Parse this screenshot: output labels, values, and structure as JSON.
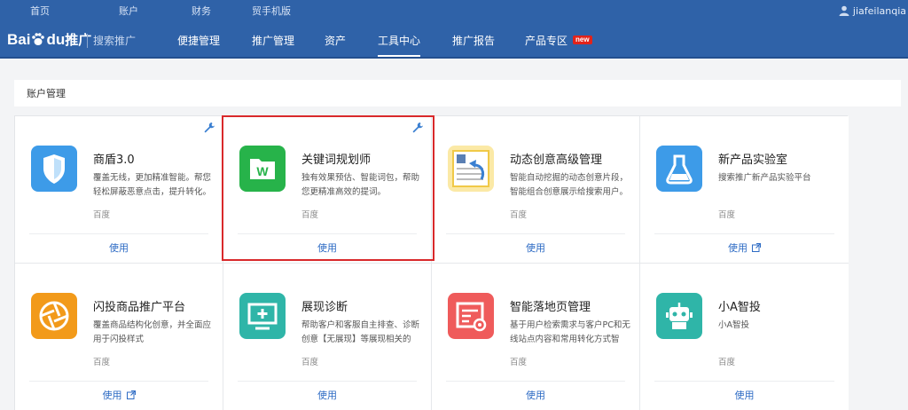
{
  "topbar": {
    "links": [
      "首页",
      "账户",
      "财务",
      "贸手机版"
    ],
    "username": "jiafeilanqia"
  },
  "nav": {
    "logo_text": "Bai",
    "logo_text2": "du",
    "logo_suffix": "推广",
    "subtitle": "搜索推广",
    "items": [
      "便捷管理",
      "推广管理",
      "资产",
      "工具中心",
      "推广报告",
      "产品专区"
    ],
    "active_item": "工具中心",
    "new_badge": "new"
  },
  "section": {
    "title": "账户管理"
  },
  "cards": [
    {
      "title": "商盾3.0",
      "desc": "覆盖无线，更加精准智能。帮您轻松屏蔽恶意点击，提升转化。",
      "vendor": "百度",
      "action": "使用",
      "icon": "shield-icon",
      "color": "#3d9be8"
    },
    {
      "title": "关键词规划师",
      "desc": "独有效果预估、智能词包，帮助您更精准高效的提词。",
      "vendor": "百度",
      "action": "使用",
      "icon": "folder-w-icon",
      "color": "#27b34a"
    },
    {
      "title": "动态创意高级管理",
      "desc": "智能自动挖掘的动态创意片段，智能组合创意展示给搜索用户。",
      "vendor": "百度",
      "action": "使用",
      "icon": "document-arrow-icon",
      "color": "#f0c948"
    },
    {
      "title": "新产品实验室",
      "desc": "搜索推广新产品实验平台",
      "vendor": "百度",
      "action": "使用",
      "icon": "flask-icon",
      "color": "#3d9be8"
    },
    {
      "title": "闪投商品推广平台",
      "desc": "覆盖商品结构化创意，并全面应用于闪投样式",
      "vendor": "百度",
      "action": "使用",
      "icon": "aperture-icon",
      "color": "#f29a1a"
    },
    {
      "title": "展现诊断",
      "desc": "帮助客户和客服自主排查、诊断创意【无展现】等展现相关的问...",
      "vendor": "百度",
      "action": "使用",
      "icon": "monitor-plus-icon",
      "color": "#2fb5a8"
    },
    {
      "title": "智能落地页管理",
      "desc": "基于用户检索需求与客户PC和无线站点内容和常用转化方式智能...",
      "vendor": "百度",
      "action": "使用",
      "icon": "page-gear-icon",
      "color": "#ef5b5b"
    },
    {
      "title": "小A智投",
      "desc": "小A智投",
      "vendor": "百度",
      "action": "使用",
      "icon": "robot-icon",
      "color": "#2fb5a8"
    }
  ]
}
